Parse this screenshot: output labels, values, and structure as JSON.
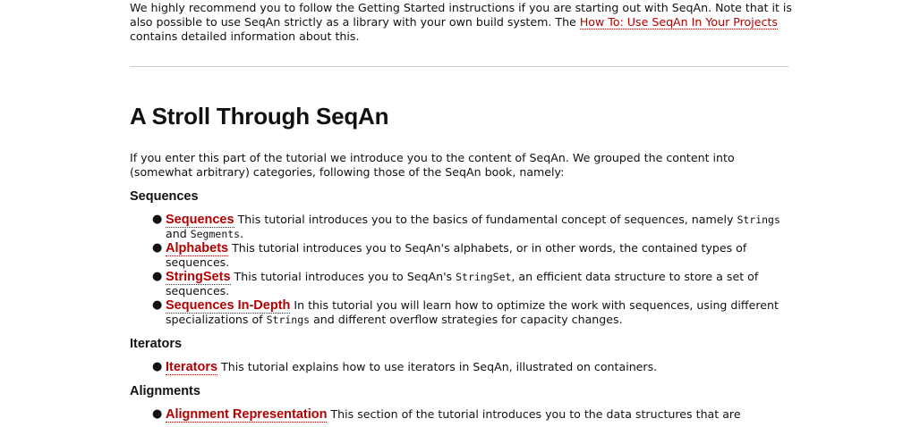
{
  "intro": {
    "text_before": "We highly recommend you to follow the Getting Started instructions if you are starting out with SeqAn. Note that it is also possible to use SeqAn strictly as a library with your own build system. The ",
    "link": "How To: Use SeqAn In Your Projects",
    "text_after": " contains detailed information about this."
  },
  "section": {
    "title": "A Stroll Through SeqAn",
    "lead": "If you enter this part of the tutorial we introduce you to the content of SeqAn. We grouped the content into (somewhat arbitrary) categories, following those of the SeqAn book, namely:"
  },
  "categories": {
    "sequences": {
      "heading": "Sequences",
      "items": [
        {
          "link": "Sequences",
          "t1": " This tutorial introduces you to the basics of fundamental concept of sequences, namely ",
          "c1": "Strings",
          "t2": " and ",
          "c2": "Segments",
          "t3": "."
        },
        {
          "link": "Alphabets",
          "t1": " This tutorial introduces you to SeqAn's alphabets, or in other words, the contained types of sequences."
        },
        {
          "link": "StringSets",
          "t1": " This tutorial introduces you to SeqAn's ",
          "c1": "StringSet",
          "t2": ", an efficient data structure to store a set of sequences."
        },
        {
          "link": "Sequences In-Depth",
          "t1": " In this tutorial you will learn how to optimize the work with sequences, using different specializations of ",
          "c1": "Strings",
          "t2": " and different overflow strategies for capacity changes."
        }
      ]
    },
    "iterators": {
      "heading": "Iterators",
      "items": [
        {
          "link": "Iterators",
          "t1": " This tutorial explains how to use iterators in SeqAn, illustrated on containers."
        }
      ]
    },
    "alignments": {
      "heading": "Alignments",
      "items": [
        {
          "link": "Alignment Representation",
          "t1": " This section of the tutorial introduces you to the data structures that are"
        }
      ]
    }
  },
  "colors": {
    "link": "#b40000",
    "text": "#111111",
    "rule": "#d0ccc4"
  }
}
